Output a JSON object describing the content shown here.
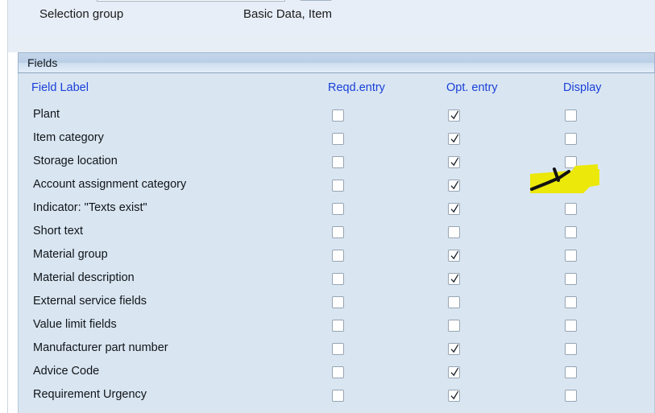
{
  "top_form": {
    "cut_off_input_value": "",
    "cut_off_button_label": "",
    "selection_group_label": "Selection group",
    "selection_group_value": "Basic Data, Item"
  },
  "group_box": {
    "title": "Fields",
    "columns": {
      "field_label": "Field Label",
      "reqd_entry": "Reqd.entry",
      "opt_entry": "Opt. entry",
      "display": "Display"
    },
    "rows": [
      {
        "label": "Plant",
        "reqd": false,
        "opt": true,
        "display": false
      },
      {
        "label": "Item category",
        "reqd": false,
        "opt": true,
        "display": false
      },
      {
        "label": "Storage location",
        "reqd": false,
        "opt": true,
        "display": false
      },
      {
        "label": "Account assignment category",
        "reqd": false,
        "opt": true,
        "display": false
      },
      {
        "label": "Indicator: \"Texts exist\"",
        "reqd": false,
        "opt": true,
        "display": false
      },
      {
        "label": "Short text",
        "reqd": false,
        "opt": false,
        "display": false
      },
      {
        "label": "Material group",
        "reqd": false,
        "opt": true,
        "display": false
      },
      {
        "label": "Material description",
        "reqd": false,
        "opt": true,
        "display": false
      },
      {
        "label": "External service fields",
        "reqd": false,
        "opt": false,
        "display": false
      },
      {
        "label": "Value limit fields",
        "reqd": false,
        "opt": false,
        "display": false
      },
      {
        "label": "Manufacturer part number",
        "reqd": false,
        "opt": true,
        "display": false
      },
      {
        "label": "Advice Code",
        "reqd": false,
        "opt": true,
        "display": false
      },
      {
        "label": "Requirement Urgency",
        "reqd": false,
        "opt": true,
        "display": false
      }
    ]
  },
  "annotation": {
    "type": "highlighter-and-pen-mark",
    "target_row_label": "Short text",
    "target_column": "Display",
    "highlight_color": "#ebe80a",
    "pen_color": "#111111"
  },
  "colors": {
    "page_background": "#e7eef7",
    "panel_background": "#d9e6f2",
    "group_header_blue": "#b9cee6",
    "column_header_text": "#1a3fd8",
    "row_text": "#111418",
    "checkbox_border": "#97a4b2"
  }
}
